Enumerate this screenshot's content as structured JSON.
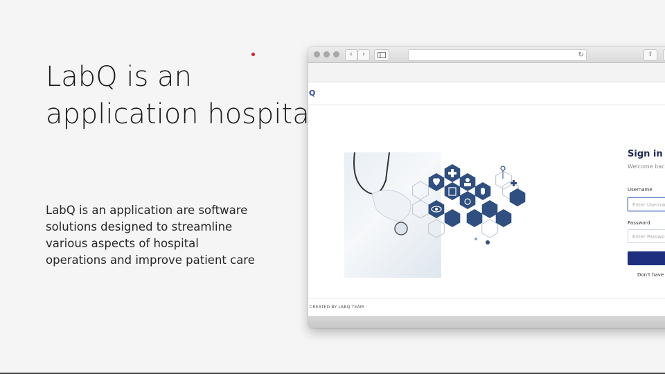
{
  "slide": {
    "title_line1": "LabQ is an",
    "title_line2": "application hospital",
    "description": "LabQ is an application are software solutions designed to streamline various aspects of hospital operations and improve patient care"
  },
  "app": {
    "logo": "Q",
    "signin": {
      "title": "Sign in",
      "welcome": "Welcome back",
      "username_label": "Username",
      "username_placeholder": "Enter Username",
      "password_label": "Password",
      "password_placeholder": "Enter Password",
      "no_account": "Don't have a"
    },
    "footer": "CREATED BY LABQ TEAM"
  },
  "colors": {
    "accent": "#1e2f80",
    "hex_icons": "#2f4f80",
    "dot": "#d21f1f"
  },
  "icons": [
    "heart-icon",
    "medical-cross-icon",
    "doctor-icon",
    "clipboard-icon",
    "eye-icon",
    "flask-icon",
    "microscope-icon",
    "pill-icon",
    "stethoscope-icon"
  ]
}
